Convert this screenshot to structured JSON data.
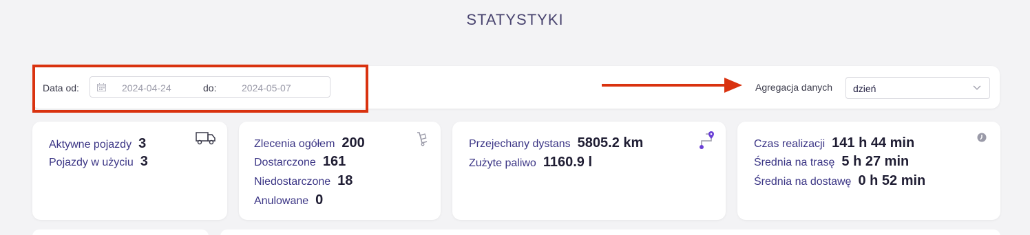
{
  "header": {
    "title": "STATYSTYKI"
  },
  "filters": {
    "date_from_label": "Data od:",
    "date_from_value": "2024-04-24",
    "date_to_label": "do:",
    "date_to_value": "2024-05-07",
    "aggregation_label": "Agregacja danych",
    "aggregation_value": "dzień"
  },
  "colors": {
    "accent": "#3b3585",
    "annotation": "#d9320f",
    "background": "#f3f3f5"
  },
  "cards": {
    "vehicles": {
      "icon": "truck-icon",
      "rows": [
        {
          "label": "Aktywne pojazdy",
          "value": "3"
        },
        {
          "label": "Pojazdy w użyciu",
          "value": "3"
        }
      ]
    },
    "orders": {
      "icon": "hand-truck-icon",
      "rows": [
        {
          "label": "Zlecenia ogółem",
          "value": "200"
        },
        {
          "label": "Dostarczone",
          "value": "161"
        },
        {
          "label": "Niedostarczone",
          "value": "18"
        },
        {
          "label": "Anulowane",
          "value": "0"
        }
      ]
    },
    "distance": {
      "icon": "route-icon",
      "rows": [
        {
          "label": "Przejechany dystans",
          "value": "5805.2 km"
        },
        {
          "label": "Zużyte paliwo",
          "value": "1160.9 l"
        }
      ]
    },
    "time": {
      "icon": "clock-icon",
      "rows": [
        {
          "label": "Czas realizacji",
          "value": "141 h 44 min"
        },
        {
          "label": "Średnia na trasę",
          "value": "5 h 27 min"
        },
        {
          "label": "Średnia na dostawę",
          "value": "0 h 52 min"
        }
      ]
    }
  }
}
